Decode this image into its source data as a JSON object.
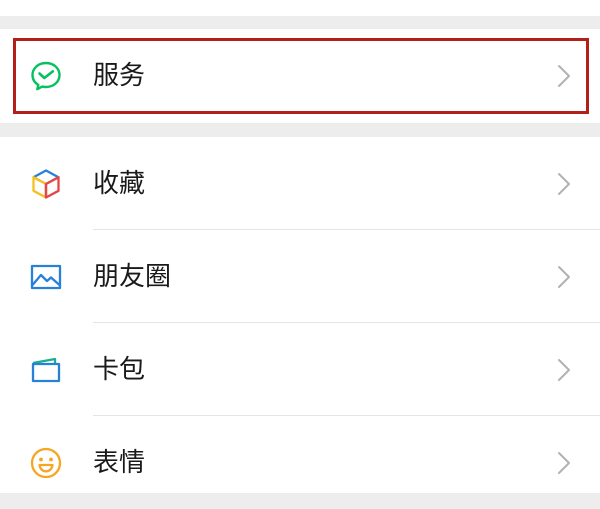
{
  "menu": {
    "service": {
      "label": "服务",
      "icon": "wechat-pay-check-icon",
      "color": "#07c160"
    },
    "items": [
      {
        "label": "收藏",
        "icon": "favorites-cube-icon"
      },
      {
        "label": "朋友圈",
        "icon": "moments-picture-icon",
        "color": "#2782d7"
      },
      {
        "label": "卡包",
        "icon": "card-wallet-icon",
        "color": "#1aad8f"
      },
      {
        "label": "表情",
        "icon": "sticker-smile-icon",
        "color": "#f5a623"
      }
    ]
  },
  "annotation": {
    "highlight_color": "#b3201a"
  }
}
